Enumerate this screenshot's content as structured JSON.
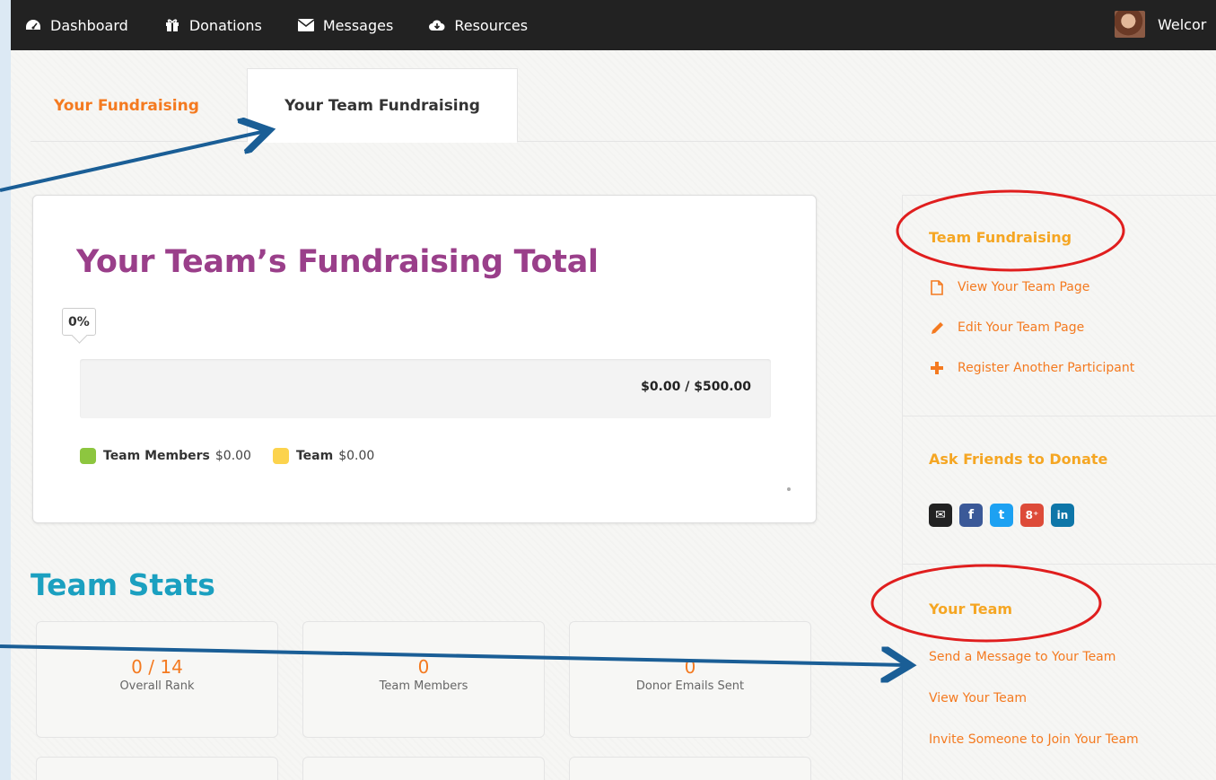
{
  "nav": {
    "items": [
      {
        "label": "Dashboard",
        "icon": "dashboard-icon"
      },
      {
        "label": "Donations",
        "icon": "gift-icon"
      },
      {
        "label": "Messages",
        "icon": "envelope-icon"
      },
      {
        "label": "Resources",
        "icon": "cloud-download-icon"
      }
    ],
    "welcome": "Welcor"
  },
  "tabs": [
    {
      "label": "Your Fundraising",
      "active": false
    },
    {
      "label": "Your Team Fundraising",
      "active": true
    }
  ],
  "total": {
    "title": "Your Team’s Fundraising Total",
    "percent_label": "0%",
    "progress_fraction": 0,
    "amount_text": "$0.00 / $500.00",
    "legend": [
      {
        "name": "Team Members",
        "value": "$0.00",
        "color": "#8dc63f"
      },
      {
        "name": "Team",
        "value": "$0.00",
        "color": "#fcd34d"
      }
    ]
  },
  "stats": {
    "title": "Team Stats",
    "items": [
      {
        "value": "0 / 14",
        "label": "Overall Rank"
      },
      {
        "value": "0",
        "label": "Team Members"
      },
      {
        "value": "0",
        "label": "Donor Emails Sent"
      }
    ]
  },
  "sidebar": {
    "team_fundraising": {
      "heading": "Team Fundraising",
      "links": [
        {
          "label": "View Your Team Page",
          "icon": "document-icon"
        },
        {
          "label": "Edit Your Team Page",
          "icon": "pencil-icon"
        },
        {
          "label": "Register Another Participant",
          "icon": "plus-icon"
        }
      ]
    },
    "ask_friends": {
      "heading": "Ask Friends to Donate",
      "social": [
        {
          "icon": "email-icon",
          "glyph": "✉",
          "color": "#222222"
        },
        {
          "icon": "facebook-icon",
          "glyph": "f",
          "color": "#3b5998"
        },
        {
          "icon": "twitter-icon",
          "glyph": "t",
          "color": "#1da1f2"
        },
        {
          "icon": "google-plus-icon",
          "glyph": "8⁺",
          "color": "#dd4b39"
        },
        {
          "icon": "linkedin-icon",
          "glyph": "in",
          "color": "#0e76a8"
        }
      ]
    },
    "your_team": {
      "heading": "Your Team",
      "links": [
        {
          "label": "Send a Message to Your Team"
        },
        {
          "label": "View Your Team"
        },
        {
          "label": "Invite Someone to Join Your Team"
        }
      ]
    }
  },
  "colors": {
    "accent_orange": "#f47a20",
    "heading_gold": "#f5a623",
    "title_purple": "#9a3f8a",
    "stats_teal": "#1ba0c0",
    "annotation_blue": "#1a5e96",
    "annotation_red": "#e01e1e"
  }
}
